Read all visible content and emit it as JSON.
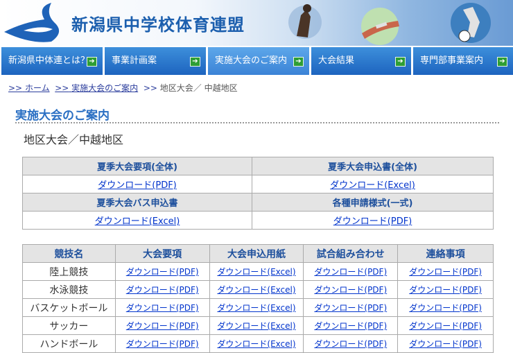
{
  "site": {
    "title": "新潟県中学校体育連盟"
  },
  "nav": [
    {
      "label": "新潟県中体連とは？"
    },
    {
      "label": "事業計画案"
    },
    {
      "label": "実施大会のご案内"
    },
    {
      "label": "大会結果"
    },
    {
      "label": "専門部事業案内"
    }
  ],
  "breadcrumb": {
    "sep": ">>",
    "home": "ホーム",
    "parent": "実施大会のご案内",
    "current": "地区大会／ 中越地区"
  },
  "section_title": "実施大会のご案内",
  "sub_title": "地区大会／中越地区",
  "summary_table": {
    "rows": [
      {
        "left_head": "夏季大会要項(全体)",
        "right_head": "夏季大会申込書(全体)",
        "left_link": "ダウンロード(PDF)",
        "right_link": "ダウンロード(Excel)"
      },
      {
        "left_head": "夏季大会バス申込書",
        "right_head": "各種申請様式(一式)",
        "left_link": "ダウンロード(Excel)",
        "right_link": "ダウンロード(PDF)"
      }
    ]
  },
  "sports_table": {
    "headers": [
      "競技名",
      "大会要項",
      "大会申込用紙",
      "試合組み合わせ",
      "連絡事項"
    ],
    "rows": [
      {
        "name": "陸上競技",
        "c1": "ダウンロード(PDF)",
        "c2": "ダウンロード(Excel)",
        "c3": "ダウンロード(PDF)",
        "c4": "ダウンロード(PDF)"
      },
      {
        "name": "水泳競技",
        "c1": "ダウンロード(PDF)",
        "c2": "ダウンロード(Excel)",
        "c3": "ダウンロード(PDF)",
        "c4": "ダウンロード(PDF)"
      },
      {
        "name": "バスケットボール",
        "c1": "ダウンロード(PDF)",
        "c2": "ダウンロード(Excel)",
        "c3": "ダウンロード(PDF)",
        "c4": "ダウンロード(PDF)"
      },
      {
        "name": "サッカー",
        "c1": "ダウンロード(PDF)",
        "c2": "ダウンロード(Excel)",
        "c3": "ダウンロード(PDF)",
        "c4": "ダウンロード(PDF)"
      },
      {
        "name": "ハンドボール",
        "c1": "ダウンロード(PDF)",
        "c2": "ダウンロード(Excel)",
        "c3": "ダウンロード(PDF)",
        "c4": "ダウンロード(PDF)"
      }
    ]
  },
  "colors": {
    "brand": "#1c5fae",
    "nav": "#1d64bf",
    "link": "#0033cc",
    "arrow": "#2e9e34"
  }
}
